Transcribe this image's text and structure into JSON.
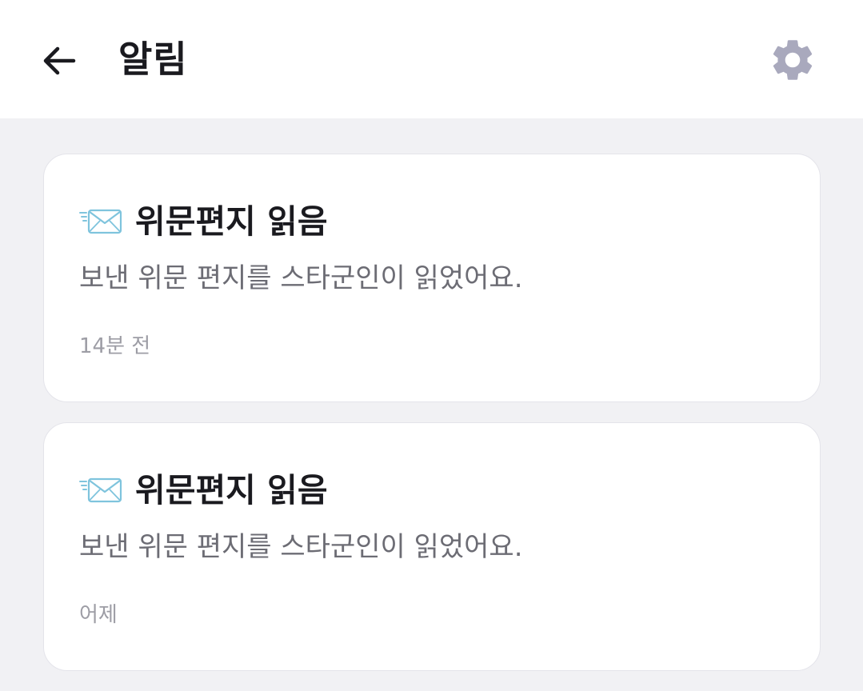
{
  "header": {
    "title": "알림",
    "back_icon": "arrow-left-icon",
    "settings_icon": "gear-icon"
  },
  "notifications": [
    {
      "icon": "envelope-icon",
      "title": "위문편지 읽음",
      "message": "보낸 위문 편지를 스타군인이 읽었어요.",
      "time": "14분 전"
    },
    {
      "icon": "envelope-icon",
      "title": "위문편지 읽음",
      "message": "보낸 위문 편지를 스타군인이 읽었어요.",
      "time": "어제"
    }
  ],
  "colors": {
    "background": "#f1f1f4",
    "header": "#ffffff",
    "title_text": "#1a1a1f",
    "body_text": "#6c6c74",
    "time_text": "#9d9da5",
    "gear": "#a9a9bd",
    "envelope": "#7fc4dd"
  }
}
